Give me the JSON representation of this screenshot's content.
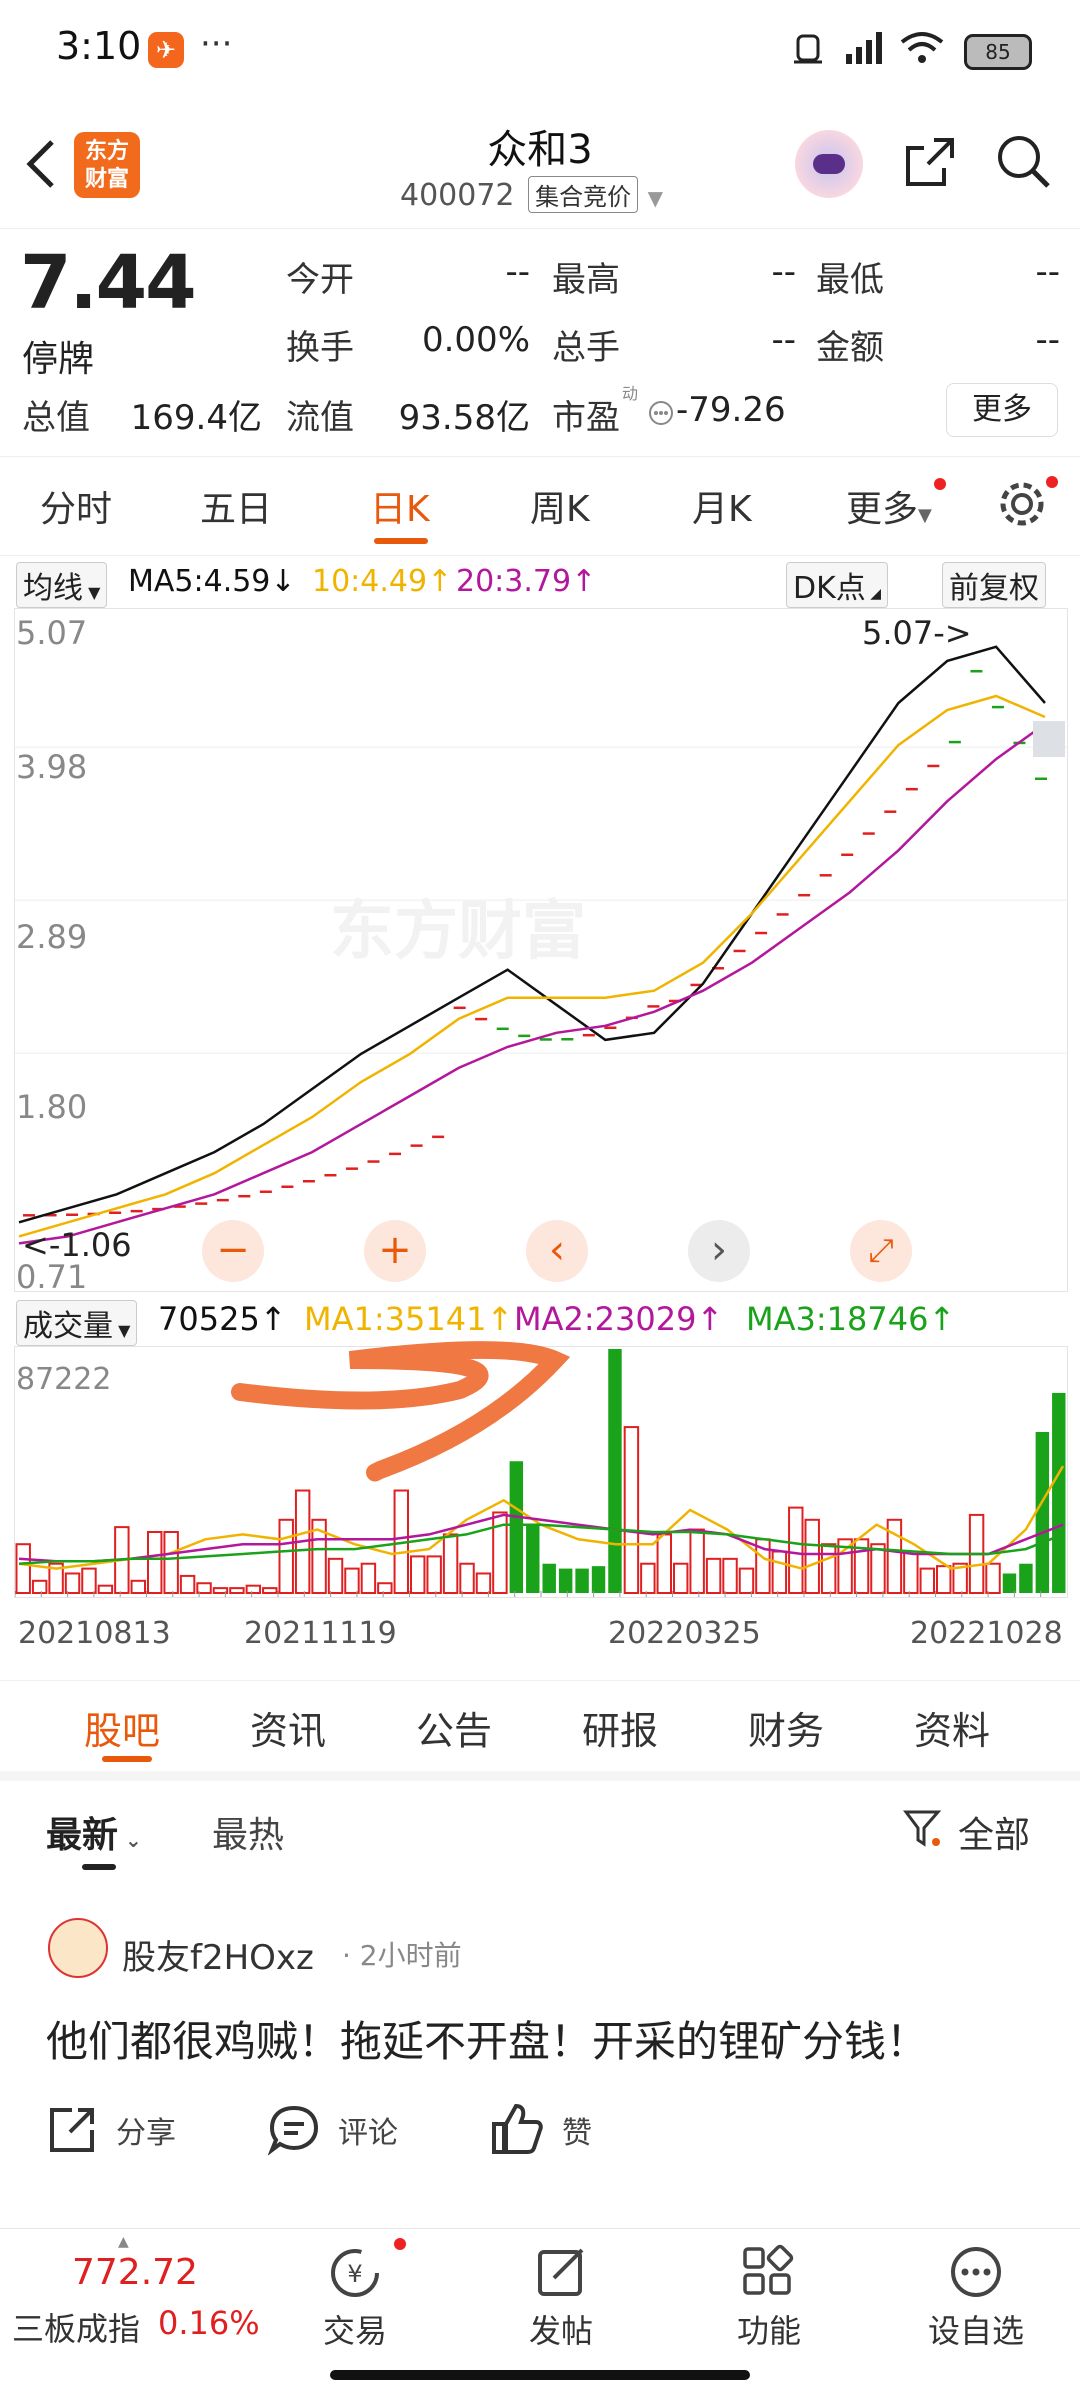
{
  "status_bar": {
    "time": "3:10",
    "battery": "85"
  },
  "header": {
    "logo_text": "东方\n财富",
    "title": "众和3",
    "code": "400072",
    "mode": "集合竞价"
  },
  "quote": {
    "price": "7.44",
    "status": "停牌",
    "fields": [
      {
        "label": "今开",
        "value": "--"
      },
      {
        "label": "最高",
        "value": "--"
      },
      {
        "label": "最低",
        "value": "--"
      },
      {
        "label": "换手",
        "value": "0.00%"
      },
      {
        "label": "总手",
        "value": "--"
      },
      {
        "label": "金额",
        "value": "--"
      },
      {
        "label": "总值",
        "value": "169.4亿"
      },
      {
        "label": "流值",
        "value": "93.58亿"
      },
      {
        "label": "市盈",
        "value": "-79.26"
      }
    ],
    "pe_superscript": "动",
    "more_label": "更多"
  },
  "tabs": [
    "分时",
    "五日",
    "日K",
    "周K",
    "月K",
    "更多"
  ],
  "active_tab": "日K",
  "ma_bar": {
    "type_label": "均线",
    "ma5": "MA5:4.59",
    "ma10": "10:4.49",
    "ma20": "20:3.79",
    "dk_label": "DK点",
    "adjust_label": "前复权"
  },
  "chart_labels": {
    "y_ticks": [
      "5.07",
      "3.98",
      "2.89",
      "1.80",
      "0.71"
    ],
    "high_marker": "5.07->",
    "low_marker": "<-1.06",
    "watermark": "东方财富"
  },
  "volume_bar": {
    "type_label": "成交量",
    "vol": "70525",
    "ma1": "MA1:35141",
    "ma2": "MA2:23029",
    "ma3": "MA3:18746",
    "max_label": "87222"
  },
  "dates": [
    "20210813",
    "20211119",
    "20220325",
    "20221028"
  ],
  "colors": {
    "up": "#e02020",
    "down": "#1aa31a",
    "ma5": "#111111",
    "ma10": "#f0b400",
    "ma20": "#b3179b",
    "accent": "#e8590c"
  },
  "chart_data": {
    "type": "line",
    "ylim": [
      0.71,
      5.07
    ],
    "series": [
      {
        "name": "MA5",
        "values": [
          0.9,
          1.0,
          1.1,
          1.25,
          1.4,
          1.6,
          1.85,
          2.1,
          2.3,
          2.5,
          2.7,
          2.45,
          2.2,
          2.25,
          2.6,
          3.1,
          3.6,
          4.1,
          4.6,
          4.9,
          5.0,
          4.6
        ]
      },
      {
        "name": "10",
        "values": [
          0.8,
          0.9,
          1.0,
          1.1,
          1.25,
          1.45,
          1.65,
          1.9,
          2.1,
          2.35,
          2.5,
          2.5,
          2.5,
          2.55,
          2.75,
          3.1,
          3.5,
          3.9,
          4.3,
          4.55,
          4.65,
          4.5
        ]
      },
      {
        "name": "20",
        "values": [
          0.75,
          0.8,
          0.9,
          1.0,
          1.1,
          1.25,
          1.4,
          1.6,
          1.8,
          2.0,
          2.15,
          2.25,
          2.3,
          2.4,
          2.55,
          2.75,
          3.0,
          3.25,
          3.55,
          3.9,
          4.2,
          4.45
        ]
      }
    ]
  },
  "volume_data": {
    "bars": [
      {
        "v": 20,
        "up": true
      },
      {
        "v": 5,
        "up": true
      },
      {
        "v": 12,
        "up": true
      },
      {
        "v": 8,
        "up": true
      },
      {
        "v": 10,
        "up": true
      },
      {
        "v": 3,
        "up": true
      },
      {
        "v": 27,
        "up": true
      },
      {
        "v": 5,
        "up": true
      },
      {
        "v": 25,
        "up": true
      },
      {
        "v": 25,
        "up": true
      },
      {
        "v": 7,
        "up": true
      },
      {
        "v": 4,
        "up": true
      },
      {
        "v": 2,
        "up": true
      },
      {
        "v": 2,
        "up": true
      },
      {
        "v": 3,
        "up": true
      },
      {
        "v": 2,
        "up": true
      },
      {
        "v": 30,
        "up": true
      },
      {
        "v": 42,
        "up": true
      },
      {
        "v": 30,
        "up": true
      },
      {
        "v": 14,
        "up": true
      },
      {
        "v": 10,
        "up": true
      },
      {
        "v": 12,
        "up": true
      },
      {
        "v": 4,
        "up": true
      },
      {
        "v": 42,
        "up": true
      },
      {
        "v": 15,
        "up": true
      },
      {
        "v": 15,
        "up": true
      },
      {
        "v": 24,
        "up": true
      },
      {
        "v": 12,
        "up": true
      },
      {
        "v": 8,
        "up": true
      },
      {
        "v": 33,
        "up": true
      },
      {
        "v": 54,
        "up": false
      },
      {
        "v": 28,
        "up": false
      },
      {
        "v": 12,
        "up": false
      },
      {
        "v": 10,
        "up": false
      },
      {
        "v": 10,
        "up": false
      },
      {
        "v": 11,
        "up": false
      },
      {
        "v": 100,
        "up": false
      },
      {
        "v": 68,
        "up": true
      },
      {
        "v": 12,
        "up": true
      },
      {
        "v": 24,
        "up": true
      },
      {
        "v": 12,
        "up": true
      },
      {
        "v": 26,
        "up": true
      },
      {
        "v": 14,
        "up": true
      },
      {
        "v": 14,
        "up": true
      },
      {
        "v": 10,
        "up": true
      },
      {
        "v": 22,
        "up": true
      },
      {
        "v": 17,
        "up": true
      },
      {
        "v": 35,
        "up": true
      },
      {
        "v": 30,
        "up": true
      },
      {
        "v": 20,
        "up": true
      },
      {
        "v": 22,
        "up": true
      },
      {
        "v": 22,
        "up": true
      },
      {
        "v": 20,
        "up": true
      },
      {
        "v": 30,
        "up": true
      },
      {
        "v": 17,
        "up": true
      },
      {
        "v": 10,
        "up": true
      },
      {
        "v": 11,
        "up": true
      },
      {
        "v": 12,
        "up": true
      },
      {
        "v": 32,
        "up": true
      },
      {
        "v": 12,
        "up": true
      },
      {
        "v": 8,
        "up": false
      },
      {
        "v": 12,
        "up": false
      },
      {
        "v": 66,
        "up": false
      },
      {
        "v": 82,
        "up": false
      }
    ],
    "ma_lines": [
      {
        "name": "MA1",
        "values": [
          12,
          10,
          12,
          14,
          16,
          22,
          24,
          22,
          26,
          20,
          16,
          18,
          30,
          38,
          28,
          22,
          20,
          20,
          34,
          26,
          14,
          10,
          16,
          28,
          20,
          10,
          12,
          26,
          52
        ]
      },
      {
        "name": "MA2",
        "values": [
          14,
          13,
          13,
          14,
          16,
          18,
          20,
          20,
          22,
          22,
          22,
          24,
          28,
          32,
          30,
          28,
          26,
          24,
          26,
          24,
          18,
          16,
          16,
          18,
          16,
          16,
          16,
          22,
          28
        ]
      },
      {
        "name": "MA3",
        "values": [
          12,
          13,
          13,
          14,
          14,
          15,
          16,
          17,
          18,
          18,
          20,
          22,
          24,
          28,
          28,
          27,
          26,
          25,
          25,
          24,
          22,
          20,
          19,
          18,
          17,
          16,
          16,
          18,
          24
        ]
      }
    ]
  },
  "subtabs": [
    "股吧",
    "资讯",
    "公告",
    "研报",
    "财务",
    "资料"
  ],
  "active_subtab": "股吧",
  "sort": {
    "latest": "最新",
    "hottest": "最热",
    "filter": "全部"
  },
  "post": {
    "user": "股友f2HOxz",
    "time": "· 2小时前",
    "body": "他们都很鸡贼！拖延不开盘！开采的锂矿分钱！",
    "share": "分享",
    "comment": "评论",
    "like": "赞"
  },
  "bottom_bar": {
    "index_value": "772.72",
    "index_name": "三板成指",
    "index_change": "0.16%",
    "items": [
      "交易",
      "发帖",
      "功能",
      "设自选"
    ]
  }
}
